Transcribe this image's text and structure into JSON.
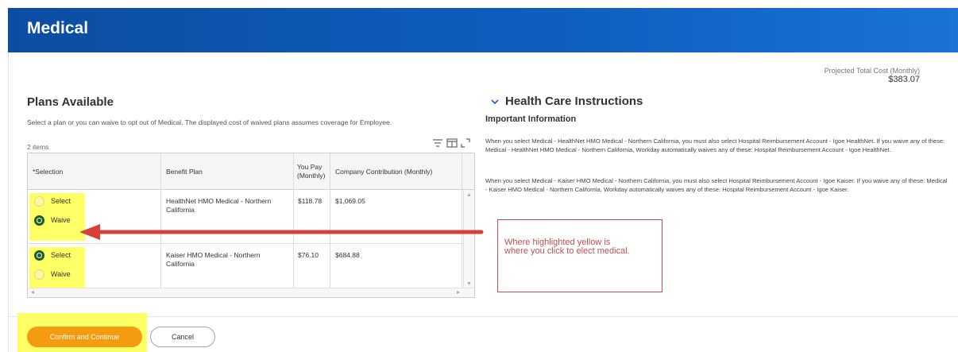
{
  "header": {
    "title": "Medical"
  },
  "projected": {
    "label": "Projected Total Cost (Monthly)",
    "value": "$383.07"
  },
  "plans": {
    "title": "Plans Available",
    "description": "Select a plan or you can waive to opt out of Medical. The displayed cost of waived plans assumes coverage for Employee.",
    "items_count": "2 items",
    "columns": [
      "*Selection",
      "Benefit Plan",
      "You Pay (Monthly)",
      "Company Contribution (Monthly)"
    ],
    "rows": [
      {
        "option_select": "Select",
        "option_waive": "Waive",
        "selected": "Waive",
        "plan": "HealthNet HMO Medical - Northern California",
        "you_pay": "$118.78",
        "company": "$1,069.05"
      },
      {
        "option_select": "Select",
        "option_waive": "Waive",
        "selected": "Select",
        "plan": "Kaiser HMO Medical - Northern California",
        "you_pay": "$76.10",
        "company": "$684.88"
      }
    ]
  },
  "instructions": {
    "title": "Health Care Instructions",
    "subtitle": "Important Information",
    "p1": "When you select Medical - HealthNet HMO Medical - Northern California, you must also select Hospital Reimbursement Account - Igoe HealthNet. If you waive any of these: Medical - HealthNet HMO Medical - Northern California, Workday automatically waives any of these: Hospital Reimbursement Account - Igoe HealthNet.",
    "p2": "When you select Medical - Kaiser HMO Medical - Northern California, you must also select Hospital Reimbursement Account - Igoe Kaiser. If you waive any of these: Medical - Kaiser HMO Medical - Northern California, Workday automatically waives any of these: Hospital Reimbursement Account - Igoe Kaiser."
  },
  "callout": {
    "line1": "Where highlighted yellow is",
    "line2": "where you click to elect medical."
  },
  "footer": {
    "confirm_label": "Confirm and Continue",
    "cancel_label": "Cancel"
  },
  "colors": {
    "header_blue": "#0f5fc0",
    "confirm_orange": "#f49b10",
    "highlight_yellow": "#ffff66",
    "arrow_red": "#d9403a",
    "radio_green": "#1a5e21"
  },
  "icons": {
    "filter": "filter-icon",
    "columns": "columns-icon",
    "expand": "expand-icon",
    "chevron": "chevron-down-icon"
  }
}
